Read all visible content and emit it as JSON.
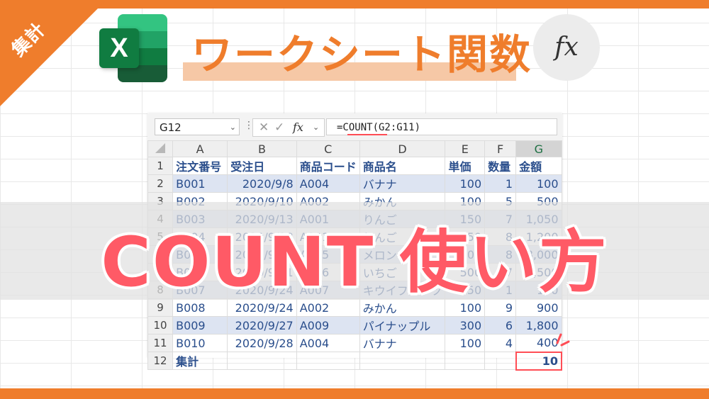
{
  "corner_label": "集計",
  "title": "ワークシート関数",
  "fx_symbol": "fx",
  "big_title": "COUNT 使い方",
  "formula_bar": {
    "name_box": "G12",
    "fx_label": "fx",
    "formula": "=COUNT(G2:G11)"
  },
  "columns": [
    "A",
    "B",
    "C",
    "D",
    "E",
    "F",
    "G"
  ],
  "selected_column": "G",
  "rows": [
    {
      "n": "1",
      "cells": [
        "注文番号",
        "受注日",
        "商品コード",
        "商品名",
        "単価",
        "数量",
        "金額"
      ]
    },
    {
      "n": "2",
      "cells": [
        "B001",
        "2020/9/8",
        "A004",
        "バナナ",
        "100",
        "1",
        "100"
      ]
    },
    {
      "n": "3",
      "cells": [
        "B002",
        "2020/9/10",
        "A002",
        "みかん",
        "100",
        "5",
        "500"
      ]
    },
    {
      "n": "4",
      "cells": [
        "B003",
        "2020/9/13",
        "A001",
        "りんご",
        "150",
        "7",
        "1,050"
      ]
    },
    {
      "n": "5",
      "cells": [
        "B004",
        "2020/9/18",
        "A001",
        "りんご",
        "150",
        "8",
        "1,200"
      ]
    },
    {
      "n": "6",
      "cells": [
        "B005",
        "2020/9/20",
        "A005",
        "メロン",
        "1000",
        "8",
        "8,000"
      ]
    },
    {
      "n": "7",
      "cells": [
        "B006",
        "2020/9/21",
        "A006",
        "いちご",
        "500",
        "7",
        "3,500"
      ]
    },
    {
      "n": "8",
      "cells": [
        "B007",
        "2020/9/24",
        "A007",
        "キウイフルーツ",
        "150",
        "1",
        "150"
      ]
    },
    {
      "n": "9",
      "cells": [
        "B008",
        "2020/9/24",
        "A002",
        "みかん",
        "100",
        "9",
        "900"
      ]
    },
    {
      "n": "10",
      "cells": [
        "B009",
        "2020/9/27",
        "A009",
        "パイナップル",
        "300",
        "6",
        "1,800"
      ]
    },
    {
      "n": "11",
      "cells": [
        "B010",
        "2020/9/28",
        "A004",
        "バナナ",
        "100",
        "4",
        "400"
      ]
    },
    {
      "n": "12",
      "cells": [
        "集計",
        "",
        "",
        "",
        "",
        "",
        "10"
      ]
    }
  ],
  "colors": {
    "accent_orange": "#ef7d2c",
    "highlight_red": "#ff5a66",
    "band_blue": "#dde4f2",
    "excel_green": "#107c41"
  }
}
